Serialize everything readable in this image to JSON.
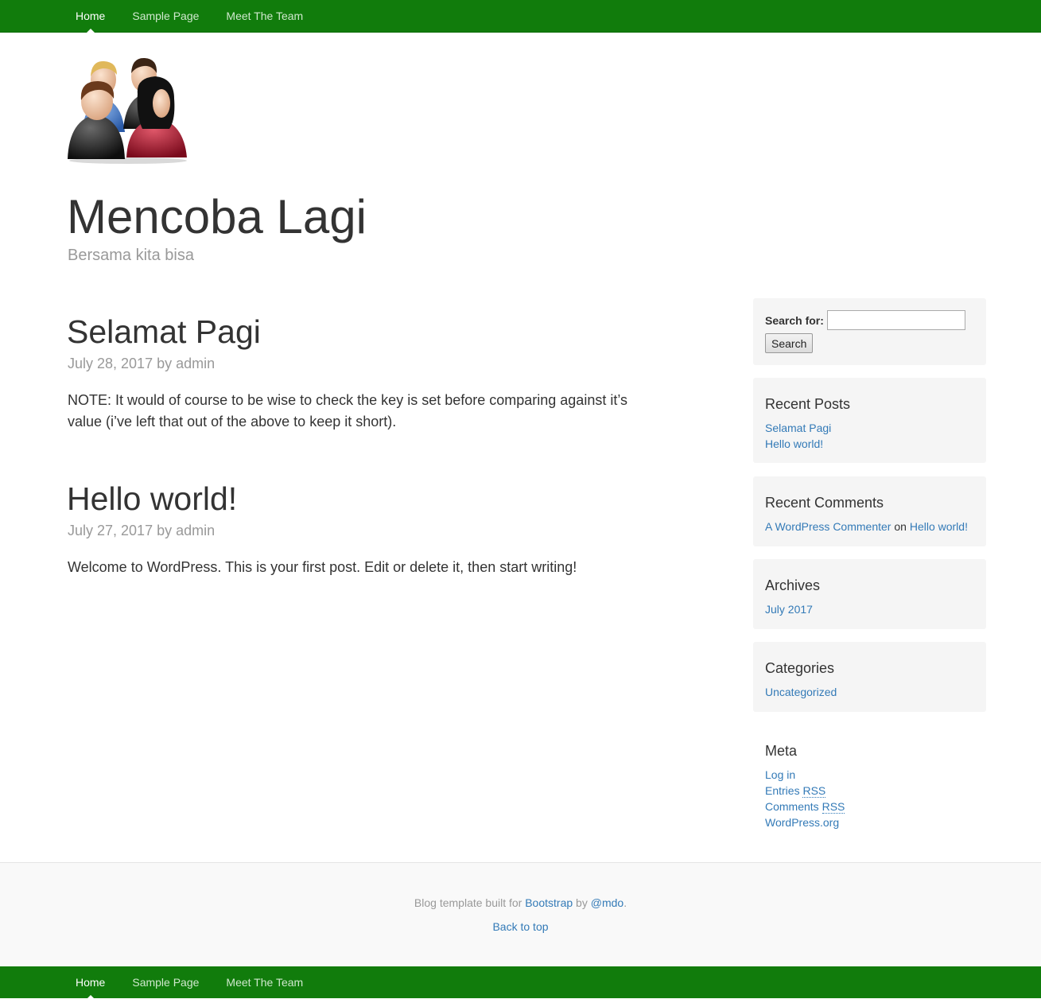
{
  "nav": {
    "items": [
      {
        "label": "Home",
        "active": true
      },
      {
        "label": "Sample Page",
        "active": false
      },
      {
        "label": "Meet The Team",
        "active": false
      }
    ]
  },
  "header": {
    "logo_icon": "team-people-icon",
    "title": "Mencoba Lagi",
    "description": "Bersama kita bisa"
  },
  "posts": [
    {
      "title": "Selamat Pagi",
      "date": "July 28, 2017",
      "by": "by",
      "author": "admin",
      "body": "NOTE: It would of course to be wise to check the key is set before comparing against it’s value (i’ve left that out of the above to keep it short)."
    },
    {
      "title": "Hello world!",
      "date": "July 27, 2017",
      "by": "by",
      "author": "admin",
      "body": "Welcome to WordPress. This is your first post. Edit or delete it, then start writing!"
    }
  ],
  "sidebar": {
    "search": {
      "label": "Search for:",
      "value": "",
      "button": "Search"
    },
    "recent_posts": {
      "title": "Recent Posts",
      "items": [
        "Selamat Pagi",
        "Hello world!"
      ]
    },
    "recent_comments": {
      "title": "Recent Comments",
      "author": "A WordPress Commenter",
      "on": "on",
      "post": "Hello world!"
    },
    "archives": {
      "title": "Archives",
      "items": [
        "July 2017"
      ]
    },
    "categories": {
      "title": "Categories",
      "items": [
        "Uncategorized"
      ]
    },
    "meta": {
      "title": "Meta",
      "log_in": "Log in",
      "entries": "Entries",
      "comments": "Comments",
      "rss": "RSS",
      "wordpress": "WordPress.org"
    }
  },
  "footer": {
    "text_prefix": "Blog template built for",
    "bootstrap": "Bootstrap",
    "by": "by",
    "mdo": "@mdo",
    "period": ".",
    "back_to_top": "Back to top"
  },
  "colors": {
    "nav_bg": "#117c0c",
    "link": "#337ab7",
    "widget_bg": "#f5f5f5"
  }
}
